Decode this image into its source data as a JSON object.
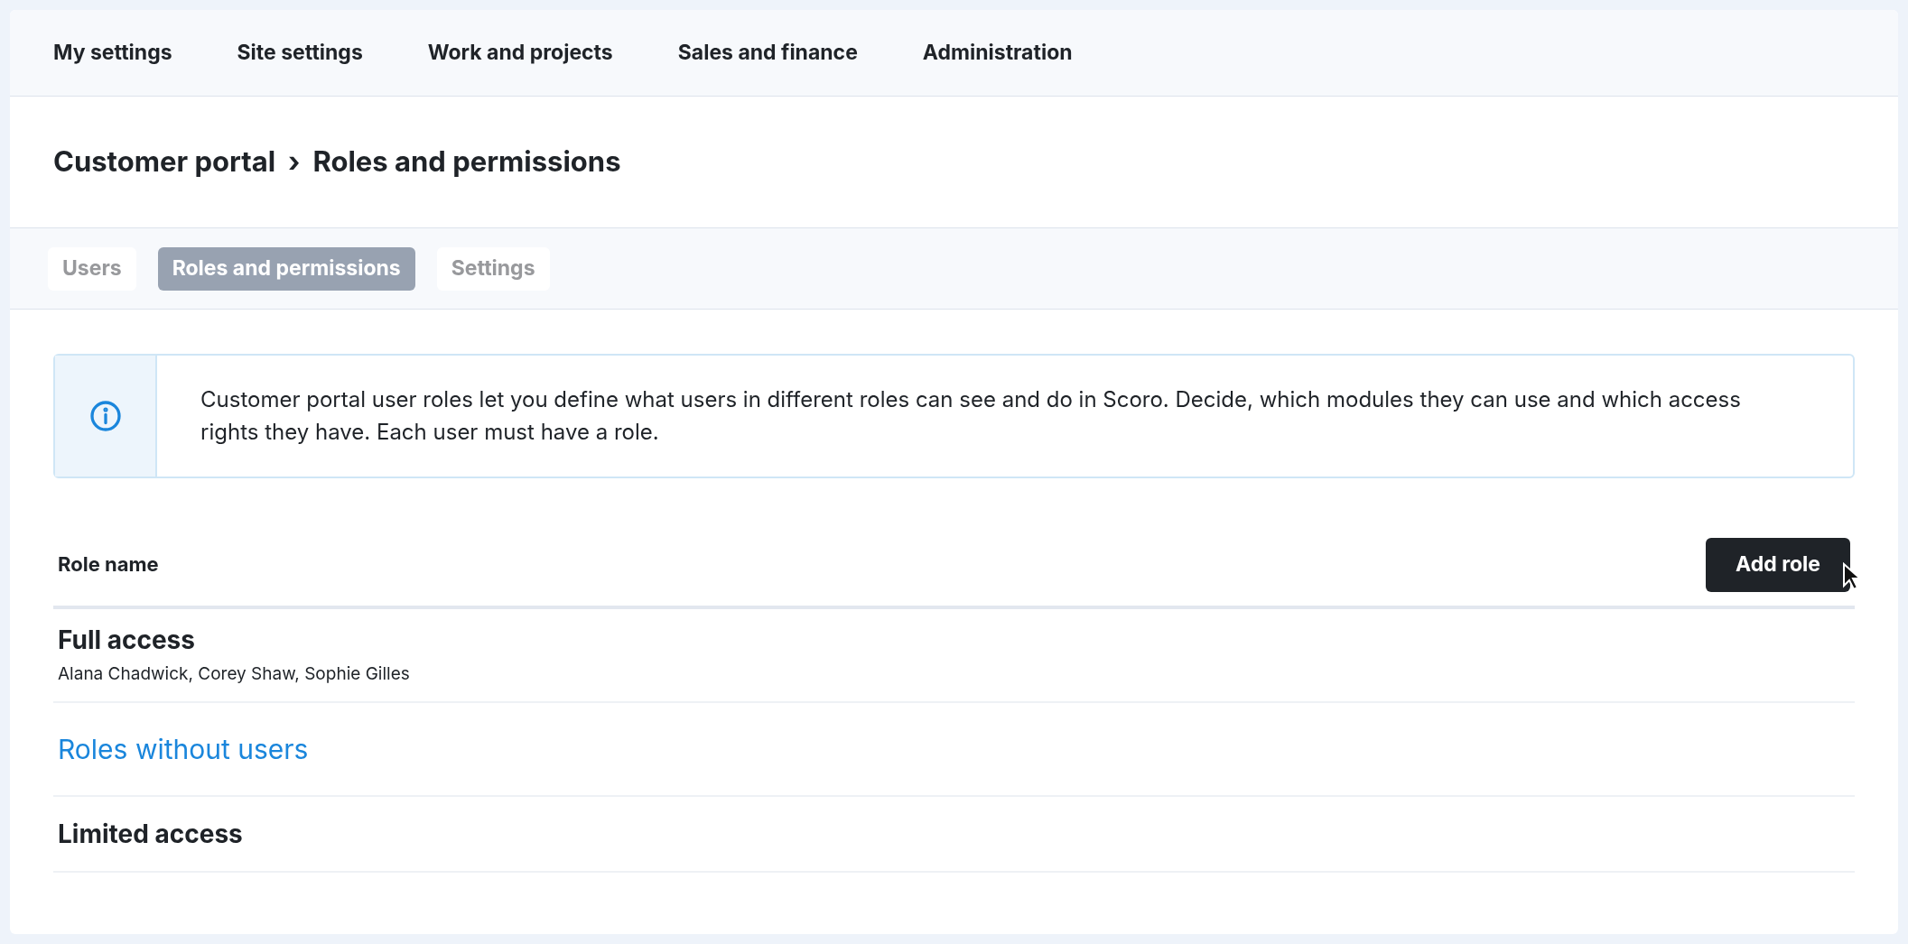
{
  "top_nav": [
    "My settings",
    "Site settings",
    "Work and projects",
    "Sales and finance",
    "Administration"
  ],
  "breadcrumb": {
    "parent": "Customer portal",
    "separator": "›",
    "current": "Roles and permissions"
  },
  "tabs": [
    {
      "label": "Users",
      "selected": false
    },
    {
      "label": "Roles and permissions",
      "selected": true
    },
    {
      "label": "Settings",
      "selected": false
    }
  ],
  "info": "Customer portal user roles let you define what users in different roles can see and do in Scoro. Decide, which modules they can use and which access rights they have. Each user must have a role.",
  "table": {
    "column": "Role name",
    "add_button": "Add role"
  },
  "rows": [
    {
      "kind": "role",
      "name": "Full access",
      "users": "Alana Chadwick, Corey Shaw, Sophie Gilles"
    },
    {
      "kind": "section",
      "name": "Roles without users"
    },
    {
      "kind": "role",
      "name": "Limited access"
    }
  ]
}
